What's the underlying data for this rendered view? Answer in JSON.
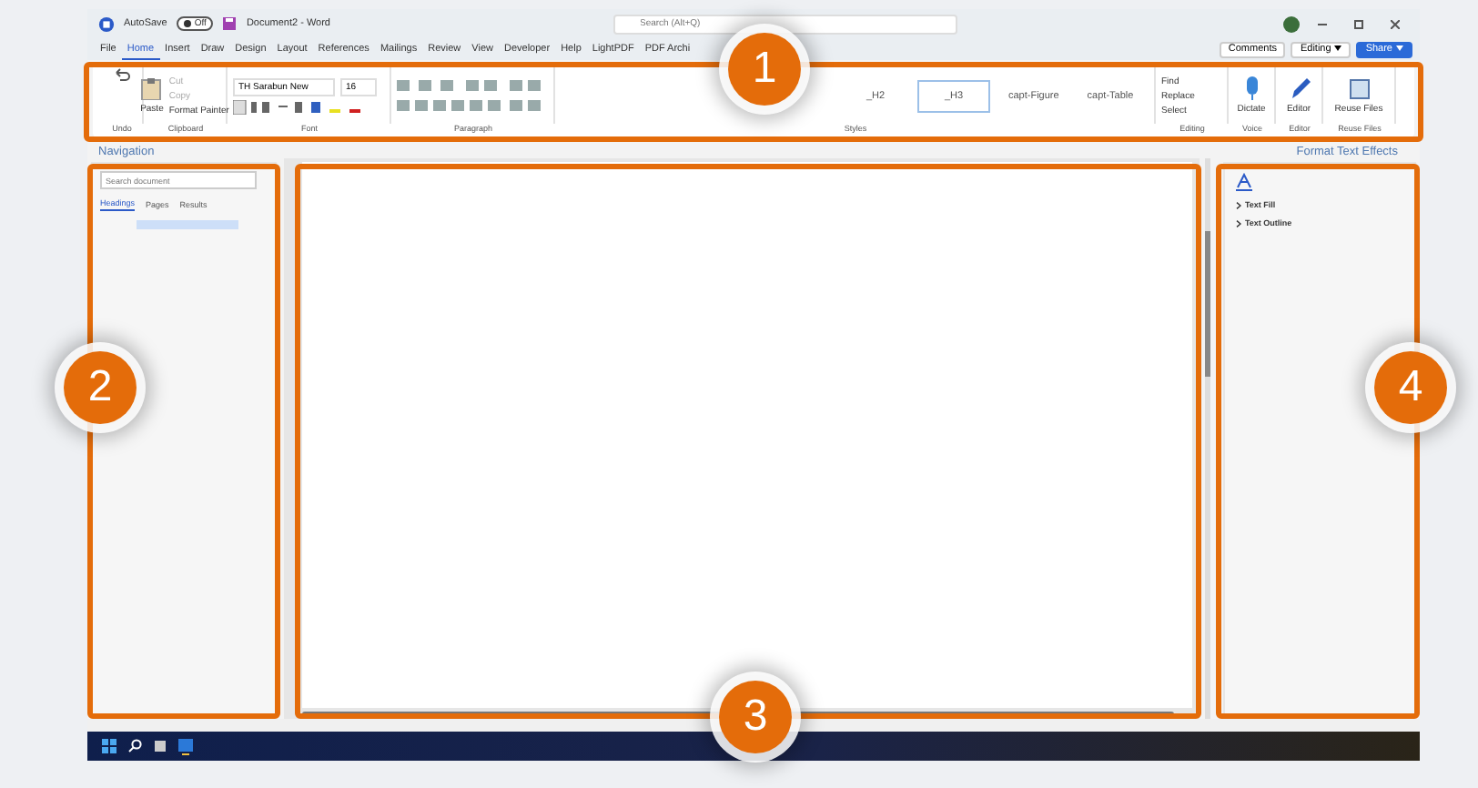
{
  "title_bar": {
    "autosave_label": "AutoSave",
    "autosave_on": false,
    "autosave_state": "Off",
    "document_title": "Document2 - Word",
    "search": {
      "placeholder": "Search (Alt+Q)"
    }
  },
  "menu_tabs": [
    {
      "label": "File",
      "selected": false
    },
    {
      "label": "Home",
      "selected": true
    },
    {
      "label": "Insert",
      "selected": false
    },
    {
      "label": "Draw",
      "selected": false
    },
    {
      "label": "Design",
      "selected": false
    },
    {
      "label": "Layout",
      "selected": false
    },
    {
      "label": "References",
      "selected": false
    },
    {
      "label": "Mailings",
      "selected": false
    },
    {
      "label": "Review",
      "selected": false
    },
    {
      "label": "View",
      "selected": false
    },
    {
      "label": "Developer",
      "selected": false
    },
    {
      "label": "Help",
      "selected": false
    },
    {
      "label": "LightPDF",
      "selected": false
    },
    {
      "label": "PDF Archi",
      "selected": false
    }
  ],
  "top_buttons": [
    {
      "label": "Comments",
      "kind": "plain"
    },
    {
      "label": "Editing",
      "kind": "dropdown"
    },
    {
      "label": "Share",
      "kind": "primary"
    }
  ],
  "ribbon": {
    "clipboard": {
      "paste": "Paste",
      "cut": "Cut",
      "copy": "Copy",
      "format_painter": "Format Painter"
    },
    "font": {
      "name": "TH Sarabun New",
      "size": "16"
    },
    "styles": [
      {
        "label": "_H2",
        "selected": false
      },
      {
        "label": "_H3",
        "selected": true
      },
      {
        "label": "capt-Figure",
        "selected": false
      },
      {
        "label": "capt-Table",
        "selected": false
      }
    ],
    "editing": [
      "Find",
      "Replace",
      "Select"
    ],
    "big_buttons": [
      {
        "label": "Dictate",
        "kind": "mic"
      },
      {
        "label": "Editor",
        "kind": "pen"
      },
      {
        "label": "Reuse Files",
        "kind": "files"
      }
    ],
    "group_labels": [
      "Undo",
      "Clipboard",
      "Font",
      "Paragraph",
      "Styles",
      "Editing",
      "Voice",
      "Editor",
      "Reuse Files"
    ]
  },
  "navigation": {
    "title": "Navigation",
    "search": {
      "placeholder": "Search document"
    },
    "tabs": [
      {
        "label": "Headings",
        "selected": true
      },
      {
        "label": "Pages",
        "selected": false
      },
      {
        "label": "Results",
        "selected": false
      }
    ]
  },
  "format_pane": {
    "title": "Format Text Effects",
    "sections": [
      "Text Fill",
      "Text Outline"
    ]
  },
  "callouts": [
    "1",
    "2",
    "3",
    "4"
  ]
}
